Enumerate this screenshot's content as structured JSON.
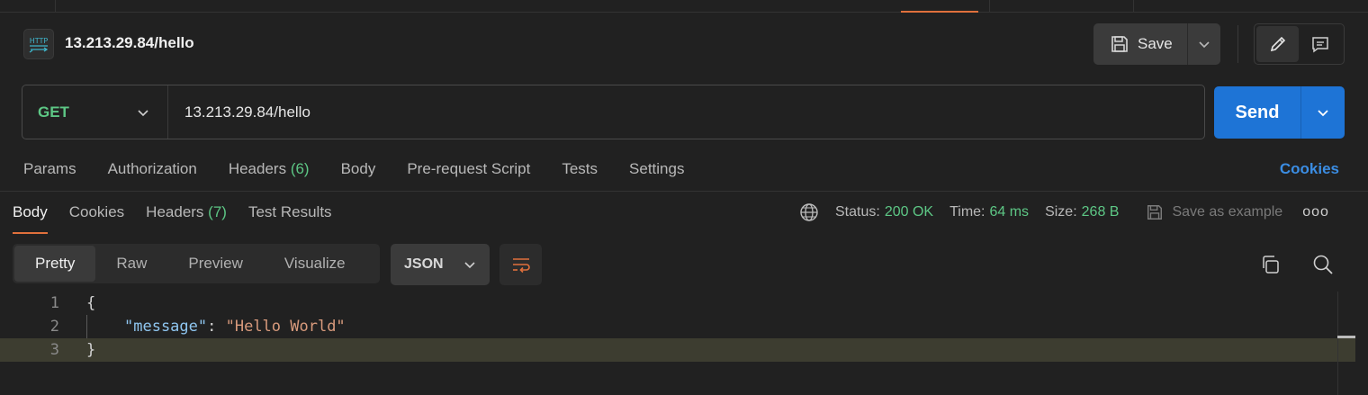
{
  "request": {
    "title": "13.213.29.84/hello",
    "method": "GET",
    "url": "13.213.29.84/hello"
  },
  "header": {
    "http_badge": "HTTP",
    "save_label": "Save"
  },
  "send_label": "Send",
  "request_tabs": [
    {
      "label": "Params"
    },
    {
      "label": "Authorization"
    },
    {
      "label": "Headers",
      "count": "(6)"
    },
    {
      "label": "Body"
    },
    {
      "label": "Pre-request Script"
    },
    {
      "label": "Tests"
    },
    {
      "label": "Settings"
    }
  ],
  "cookies_link": "Cookies",
  "response_tabs": [
    {
      "label": "Body"
    },
    {
      "label": "Cookies"
    },
    {
      "label": "Headers",
      "count": "(7)"
    },
    {
      "label": "Test Results"
    }
  ],
  "response_status": {
    "status_label": "Status:",
    "status_value": "200 OK",
    "time_label": "Time:",
    "time_value": "64 ms",
    "size_label": "Size:",
    "size_value": "268 B",
    "save_example": "Save as example",
    "more": "ooo"
  },
  "format_tabs": [
    {
      "label": "Pretty"
    },
    {
      "label": "Raw"
    },
    {
      "label": "Preview"
    },
    {
      "label": "Visualize"
    }
  ],
  "format_select": "JSON",
  "code": {
    "line_numbers": [
      "1",
      "2",
      "3"
    ],
    "open_brace": "{",
    "key": "\"message\"",
    "colon": ": ",
    "value": "\"Hello World\"",
    "close_brace": "}"
  },
  "colors": {
    "accent": "#e0703c",
    "send": "#1e74d6",
    "method": "#5dc785",
    "cookies": "#3b8de3"
  }
}
